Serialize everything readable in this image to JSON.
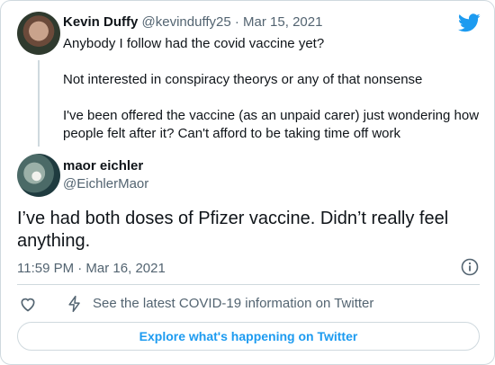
{
  "colors": {
    "accent": "#1d9bf0",
    "muted": "#536471",
    "text": "#0f1419",
    "border": "#cfd9de"
  },
  "tweet1": {
    "author_name": "Kevin Duffy",
    "handle": "@kevinduffy25",
    "separator": "·",
    "date": "Mar 15, 2021",
    "line1": "Anybody I follow had the covid vaccine yet?",
    "line2": "Not interested in conspiracy theorys or any of that nonsense",
    "line3": "I've been offered the vaccine (as an unpaid carer) just wondering how people felt after it? Can't afford to be taking time off work"
  },
  "tweet2": {
    "author_name": "maor eichler",
    "handle": "@EichlerMaor",
    "text": "I’ve had both doses of Pfizer vaccine. Didn’t really feel anything.",
    "timestamp": "11:59 PM · Mar 16, 2021"
  },
  "actions": {
    "covid_info": "See the latest COVID-19 information on Twitter"
  },
  "explore_label": "Explore what's happening on Twitter",
  "icons": [
    "twitter-bird-icon",
    "info-icon",
    "heart-icon",
    "lightning-bolt-icon"
  ]
}
